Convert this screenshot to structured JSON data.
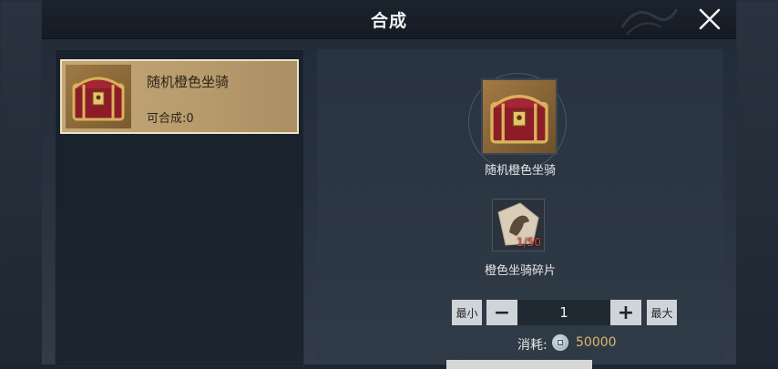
{
  "dialog": {
    "title": "合成"
  },
  "list": {
    "items": [
      {
        "name": "随机橙色坐骑",
        "synth_label": "可合成:0",
        "icon": "treasure-chest-icon",
        "selected": true
      }
    ]
  },
  "detail": {
    "target": {
      "name": "随机橙色坐骑",
      "icon": "treasure-chest-icon"
    },
    "material": {
      "name": "橙色坐骑碎片",
      "count": "1/50",
      "icon": "mount-fragment-icon"
    },
    "quantity": {
      "min_label": "最小",
      "max_label": "最大",
      "value": "1"
    },
    "cost": {
      "label": "消耗:",
      "value": "50000",
      "icon": "silver-coin-icon"
    }
  },
  "colors": {
    "accent_gold": "#d8b86a",
    "shortage_red": "#e04535",
    "selected_card": "#c4a777"
  }
}
